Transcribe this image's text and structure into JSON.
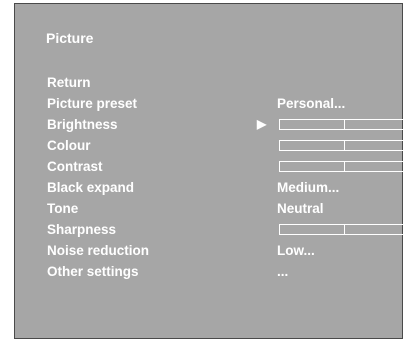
{
  "menu_title": "Picture",
  "items": [
    {
      "label": "Return",
      "value": "",
      "kind": "action"
    },
    {
      "label": "Picture preset",
      "value": "Personal...",
      "kind": "value"
    },
    {
      "label": "Brightness",
      "value": "",
      "kind": "slider",
      "level": 0.5,
      "selected": true,
      "pointer": "▶"
    },
    {
      "label": "Colour",
      "value": "",
      "kind": "slider",
      "level": 0.5
    },
    {
      "label": "Contrast",
      "value": "",
      "kind": "slider",
      "level": 0.5
    },
    {
      "label": "Black expand",
      "value": "Medium...",
      "kind": "value"
    },
    {
      "label": "Tone",
      "value": "Neutral",
      "kind": "value"
    },
    {
      "label": "Sharpness",
      "value": "",
      "kind": "slider",
      "level": 0.5
    },
    {
      "label": "Noise reduction",
      "value": "Low...",
      "kind": "value"
    },
    {
      "label": "Other settings",
      "value": "...",
      "kind": "value"
    }
  ],
  "colors": {
    "panel_background": "#a6a6a6",
    "text": "#ffffff",
    "border": "#4a4a4a"
  }
}
